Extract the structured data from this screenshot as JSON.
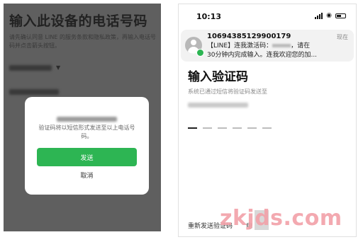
{
  "left_screen": {
    "title": "输入此设备的电话号码",
    "terms_text": "请先确认同意 LINE 的服务条款和隐私政策，再输入电话号码并点击箭头按钮。",
    "dialog": {
      "message": "验证码将以短信形式发送至以上电话号码。",
      "send_label": "发送",
      "cancel_label": "取消",
      "send_color": "#2db553"
    }
  },
  "right_screen": {
    "status_bar": {
      "time": "10:13"
    },
    "notification": {
      "sender": "10694385129900179",
      "time": "现在",
      "line1_prefix": "【LINE】连我激活码：",
      "line1_suffix": "，请在",
      "line2": "30分钟内完成输入。连我欢迎您的加..."
    },
    "title": "输入验证码",
    "subtitle": "系统已通过短信将验证码发送至",
    "code_slot_count": 6,
    "resend_label": "重新发送验证码",
    "resend_tail": "电"
  },
  "watermark": {
    "text": "zkjds.com",
    "color": "#f2a2aa"
  }
}
